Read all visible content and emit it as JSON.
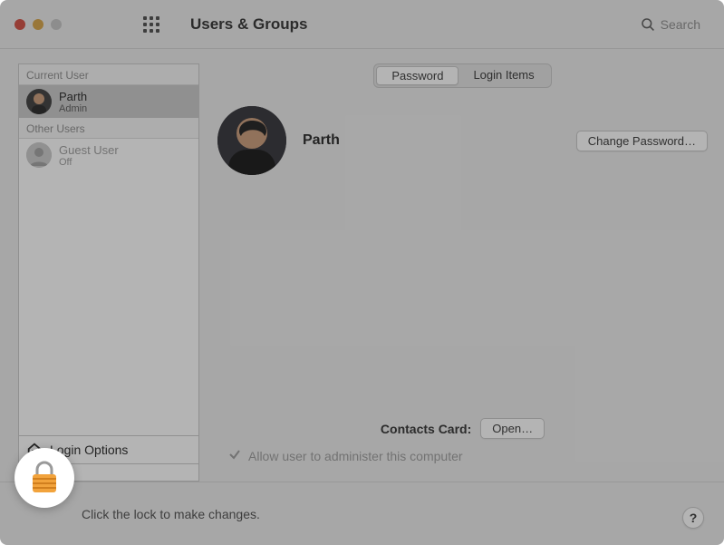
{
  "toolbar": {
    "title": "Users & Groups",
    "search_placeholder": "Search",
    "icon_back": "chevron-left-icon",
    "icon_forward": "chevron-right-icon",
    "icon_apps": "grid-apps-icon",
    "icon_search": "search-icon"
  },
  "sidebar": {
    "sections": [
      {
        "header": "Current User",
        "users": [
          {
            "name": "Parth",
            "role": "Admin",
            "selected": true
          }
        ]
      },
      {
        "header": "Other Users",
        "users": [
          {
            "name": "Guest User",
            "role": "Off",
            "selected": false
          }
        ]
      }
    ],
    "login_options_label": "Login Options",
    "add_label": "+",
    "remove_label": "−"
  },
  "tabs": {
    "items": [
      {
        "label": "Password",
        "active": true
      },
      {
        "label": "Login Items",
        "active": false
      }
    ]
  },
  "main": {
    "user_name": "Parth",
    "change_password_label": "Change Password…",
    "contacts_label": "Contacts Card:",
    "open_label": "Open…",
    "admin_checkbox_label": "Allow user to administer this computer",
    "admin_checked": true
  },
  "footer": {
    "lock_hint": "Click the lock to make changes.",
    "help_label": "?",
    "lock_icon": "lock-icon"
  },
  "colors": {
    "lock_body": "#f2a33c",
    "lock_stripe": "#d17f1e"
  }
}
